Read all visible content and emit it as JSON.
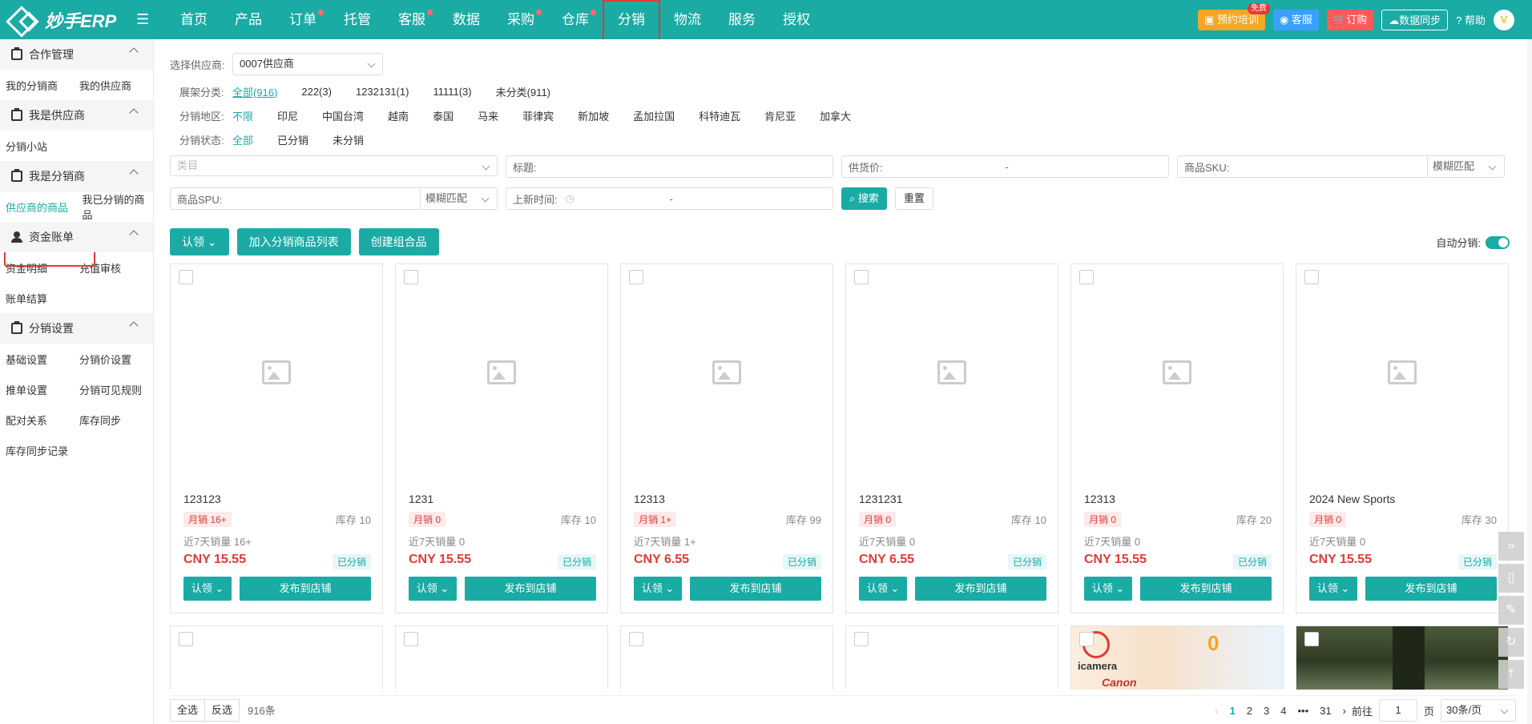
{
  "header": {
    "logo_text": "妙手ERP",
    "nav": [
      {
        "label": "首页",
        "dot": false
      },
      {
        "label": "产品",
        "dot": false
      },
      {
        "label": "订单",
        "dot": true
      },
      {
        "label": "托管",
        "dot": false
      },
      {
        "label": "客服",
        "dot": true
      },
      {
        "label": "数据",
        "dot": false
      },
      {
        "label": "采购",
        "dot": true
      },
      {
        "label": "仓库",
        "dot": true
      },
      {
        "label": "分销",
        "dot": false,
        "active": true
      },
      {
        "label": "物流",
        "dot": false
      },
      {
        "label": "服务",
        "dot": false
      },
      {
        "label": "授权",
        "dot": false
      }
    ],
    "training_label": "预约培训",
    "training_badge": "免费",
    "service_label": "客服",
    "order_label": "订购",
    "sync_label": "数据同步",
    "help_label": "帮助",
    "avatar_letter": "V",
    "accent": "#1aaba4"
  },
  "sidebar": {
    "sections": [
      {
        "title": "合作管理",
        "items": [
          "我的分销商",
          "我的供应商"
        ]
      },
      {
        "title": "我是供应商",
        "items": [
          "分销小站"
        ]
      },
      {
        "title": "我是分销商",
        "items": [
          "供应商的商品",
          "我已分销的商品"
        ]
      },
      {
        "title": "资金账单",
        "items": [
          "资金明细",
          "充值审核",
          "账单结算"
        ]
      },
      {
        "title": "分销设置",
        "items": [
          "基础设置",
          "分销价设置",
          "推单设置",
          "分销可见规则",
          "配对关系",
          "库存同步",
          "库存同步记录"
        ]
      }
    ]
  },
  "filters": {
    "supplier_label": "选择供应商:",
    "supplier_value": "0007供应商",
    "shelf_label": "展架分类:",
    "shelf_options": [
      "全部(916)",
      "222(3)",
      "1232131(1)",
      "11111(3)",
      "未分类(911)"
    ],
    "region_label": "分销地区:",
    "region_options": [
      "不限",
      "印尼",
      "中国台湾",
      "越南",
      "泰国",
      "马来",
      "菲律宾",
      "新加坡",
      "孟加拉国",
      "科特迪瓦",
      "肯尼亚",
      "加拿大"
    ],
    "status_label": "分销状态:",
    "status_options": [
      "全部",
      "已分销",
      "未分销"
    ]
  },
  "search": {
    "category_placeholder": "类目",
    "title_label": "标题:",
    "price_label": "供货价:",
    "sku_label": "商品SKU:",
    "match_label": "模糊匹配",
    "spu_label": "商品SPU:",
    "newtime_label": "上新时间:",
    "dash": "-",
    "search_btn": "搜索",
    "reset_btn": "重置"
  },
  "actions": {
    "claim": "认领",
    "add_list": "加入分销商品列表",
    "create_combo": "创建组合品",
    "auto_label": "自动分销:"
  },
  "products": [
    {
      "name": "123123",
      "sales": "月销 16+",
      "stock": "库存 10",
      "sales7": "近7天销量 16+",
      "price": "CNY 15.55",
      "status": "已分销"
    },
    {
      "name": "1231",
      "sales": "月销 0",
      "stock": "库存 10",
      "sales7": "近7天销量 0",
      "price": "CNY 15.55",
      "status": "已分销"
    },
    {
      "name": "12313",
      "sales": "月销 1+",
      "stock": "库存 99",
      "sales7": "近7天销量 1+",
      "price": "CNY 6.55",
      "status": "已分销"
    },
    {
      "name": "1231231",
      "sales": "月销 0",
      "stock": "库存 10",
      "sales7": "近7天销量 0",
      "price": "CNY 6.55",
      "status": "已分销"
    },
    {
      "name": "12313",
      "sales": "月销 0",
      "stock": "库存 20",
      "sales7": "近7天销量 0",
      "price": "CNY 15.55",
      "status": "已分销"
    },
    {
      "name": "2024 New Sports",
      "sales": "月销 0",
      "stock": "库存 30",
      "sales7": "近7天销量 0",
      "price": "CNY 15.55",
      "status": "已分销"
    }
  ],
  "card_buttons": {
    "claim": "认领",
    "publish": "发布到店铺"
  },
  "ad": {
    "brand": "icamera",
    "canon": "Canon",
    "zero": "0"
  },
  "bottom": {
    "select_all": "全选",
    "invert": "反选",
    "count": "916条",
    "pages": [
      "1",
      "2",
      "3",
      "4",
      "•••",
      "31"
    ],
    "goto_label": "前往",
    "goto_value": "1",
    "page_unit": "页",
    "page_size": "30条/页"
  }
}
